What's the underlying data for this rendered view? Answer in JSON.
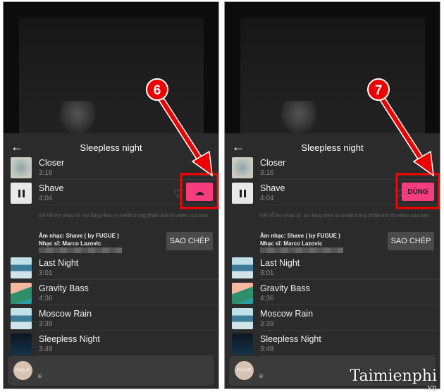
{
  "panels": [
    {
      "step": "6",
      "action": "download"
    },
    {
      "step": "7",
      "action": "use"
    }
  ],
  "header": {
    "title": "Sleepless night"
  },
  "tracks": [
    {
      "name": "Closer",
      "duration": "3:16"
    },
    {
      "name": "Shave",
      "duration": "4:04"
    },
    {
      "name": "Last Night",
      "duration": "3:01"
    },
    {
      "name": "Gravity Bass",
      "duration": "4:36"
    },
    {
      "name": "Moscow Rain",
      "duration": "3:39"
    },
    {
      "name": "Sleepless Night",
      "duration": "3:49"
    }
  ],
  "credit": {
    "note": "Để hỗ trợ nhạc sĩ, vui lòng đưa ra credit trong phần mô tả video của bạn.",
    "music": "Âm nhạc: Shave ( by FUGUE )",
    "artist": "Nhạc sĩ: Marco Lazovic",
    "copy_label": "SAO CHÉP"
  },
  "use_label": "DÙNG",
  "avatar_text": "FUGUE",
  "watermark": "Taimienphi.vn",
  "colors": {
    "accent": "#f43c7f",
    "annotation": "#ff0000"
  }
}
